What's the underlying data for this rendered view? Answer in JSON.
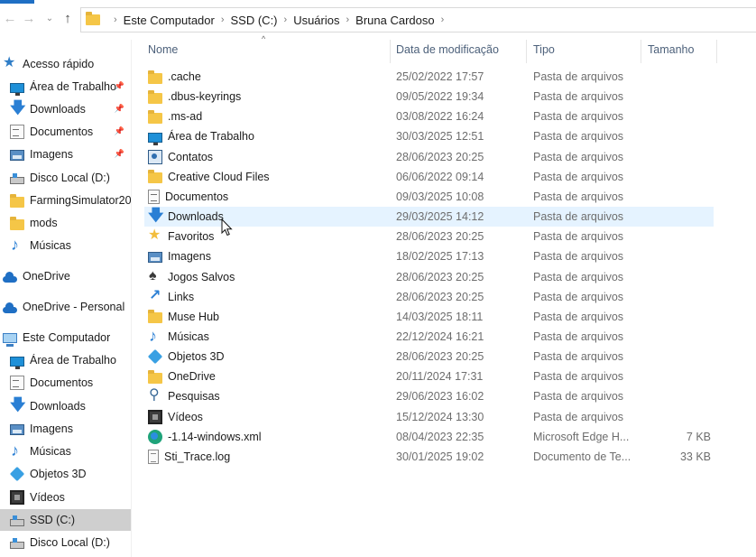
{
  "window": {
    "accent_color": "#1f6fc4"
  },
  "address_bar": {
    "crumbs": [
      "Este Computador",
      "SSD (C:)",
      "Usuários",
      "Bruna Cardoso"
    ]
  },
  "sidebar": {
    "items": [
      {
        "label": "Acesso rápido",
        "icon": "star-icon",
        "pinned": false,
        "indent": false
      },
      {
        "label": "Área de Trabalho",
        "icon": "desktop-icon",
        "pinned": true,
        "indent": true
      },
      {
        "label": "Downloads",
        "icon": "download-icon",
        "pinned": true,
        "indent": true
      },
      {
        "label": "Documentos",
        "icon": "document-icon",
        "pinned": true,
        "indent": true
      },
      {
        "label": "Imagens",
        "icon": "images-icon",
        "pinned": true,
        "indent": true
      },
      {
        "label": "Disco Local (D:)",
        "icon": "drive-icon",
        "pinned": false,
        "indent": true
      },
      {
        "label": "FarmingSimulator20",
        "icon": "folder-icon",
        "pinned": false,
        "indent": true
      },
      {
        "label": "mods",
        "icon": "folder-icon",
        "pinned": false,
        "indent": true
      },
      {
        "label": "Músicas",
        "icon": "music-icon",
        "pinned": false,
        "indent": true
      },
      {
        "label": "OneDrive",
        "icon": "cloud-icon",
        "pinned": false,
        "indent": false
      },
      {
        "label": "OneDrive - Personal",
        "icon": "cloud-icon",
        "pinned": false,
        "indent": false
      },
      {
        "label": "Este Computador",
        "icon": "computer-icon",
        "pinned": false,
        "indent": false
      },
      {
        "label": "Área de Trabalho",
        "icon": "desktop-icon",
        "pinned": false,
        "indent": true
      },
      {
        "label": "Documentos",
        "icon": "document-icon",
        "pinned": false,
        "indent": true
      },
      {
        "label": "Downloads",
        "icon": "download-icon",
        "pinned": false,
        "indent": true
      },
      {
        "label": "Imagens",
        "icon": "images-icon",
        "pinned": false,
        "indent": true
      },
      {
        "label": "Músicas",
        "icon": "music-icon",
        "pinned": false,
        "indent": true
      },
      {
        "label": "Objetos 3D",
        "icon": "objects-3d-icon",
        "pinned": false,
        "indent": true
      },
      {
        "label": "Vídeos",
        "icon": "video-icon",
        "pinned": false,
        "indent": true
      },
      {
        "label": "SSD (C:)",
        "icon": "drive-icon",
        "pinned": false,
        "indent": true,
        "selected": true
      },
      {
        "label": "Disco Local (D:)",
        "icon": "drive-icon",
        "pinned": false,
        "indent": true
      }
    ]
  },
  "columns": {
    "name": "Nome",
    "date": "Data de modificação",
    "type": "Tipo",
    "size": "Tamanho"
  },
  "files": [
    {
      "name": ".cache",
      "date": "25/02/2022 17:57",
      "type": "Pasta de arquivos",
      "size": "",
      "icon": "folder-icon"
    },
    {
      "name": ".dbus-keyrings",
      "date": "09/05/2022 19:34",
      "type": "Pasta de arquivos",
      "size": "",
      "icon": "folder-icon"
    },
    {
      "name": ".ms-ad",
      "date": "03/08/2022 16:24",
      "type": "Pasta de arquivos",
      "size": "",
      "icon": "folder-icon"
    },
    {
      "name": "Área de Trabalho",
      "date": "30/03/2025 12:51",
      "type": "Pasta de arquivos",
      "size": "",
      "icon": "desktop-icon"
    },
    {
      "name": "Contatos",
      "date": "28/06/2023 20:25",
      "type": "Pasta de arquivos",
      "size": "",
      "icon": "contacts-icon"
    },
    {
      "name": "Creative Cloud Files",
      "date": "06/06/2022 09:14",
      "type": "Pasta de arquivos",
      "size": "",
      "icon": "folder-icon"
    },
    {
      "name": "Documentos",
      "date": "09/03/2025 10:08",
      "type": "Pasta de arquivos",
      "size": "",
      "icon": "document-icon"
    },
    {
      "name": "Downloads",
      "date": "29/03/2025 14:12",
      "type": "Pasta de arquivos",
      "size": "",
      "icon": "download-icon",
      "hover": true
    },
    {
      "name": "Favoritos",
      "date": "28/06/2023 20:25",
      "type": "Pasta de arquivos",
      "size": "",
      "icon": "favorites-icon"
    },
    {
      "name": "Imagens",
      "date": "18/02/2025 17:13",
      "type": "Pasta de arquivos",
      "size": "",
      "icon": "images-icon"
    },
    {
      "name": "Jogos Salvos",
      "date": "28/06/2023 20:25",
      "type": "Pasta de arquivos",
      "size": "",
      "icon": "saved-games-icon"
    },
    {
      "name": "Links",
      "date": "28/06/2023 20:25",
      "type": "Pasta de arquivos",
      "size": "",
      "icon": "links-icon"
    },
    {
      "name": "Muse Hub",
      "date": "14/03/2025 18:11",
      "type": "Pasta de arquivos",
      "size": "",
      "icon": "folder-icon"
    },
    {
      "name": "Músicas",
      "date": "22/12/2024 16:21",
      "type": "Pasta de arquivos",
      "size": "",
      "icon": "music-icon"
    },
    {
      "name": "Objetos 3D",
      "date": "28/06/2023 20:25",
      "type": "Pasta de arquivos",
      "size": "",
      "icon": "objects-3d-icon"
    },
    {
      "name": "OneDrive",
      "date": "20/11/2024 17:31",
      "type": "Pasta de arquivos",
      "size": "",
      "icon": "folder-icon"
    },
    {
      "name": "Pesquisas",
      "date": "29/06/2023 16:02",
      "type": "Pasta de arquivos",
      "size": "",
      "icon": "searches-icon"
    },
    {
      "name": "Vídeos",
      "date": "15/12/2024 13:30",
      "type": "Pasta de arquivos",
      "size": "",
      "icon": "video-icon"
    },
    {
      "name": "-1.14-windows.xml",
      "date": "08/04/2023 22:35",
      "type": "Microsoft Edge H...",
      "size": "7 KB",
      "icon": "edge-icon"
    },
    {
      "name": "Sti_Trace.log",
      "date": "30/01/2025 19:02",
      "type": "Documento de Te...",
      "size": "33 KB",
      "icon": "text-file-icon"
    }
  ]
}
